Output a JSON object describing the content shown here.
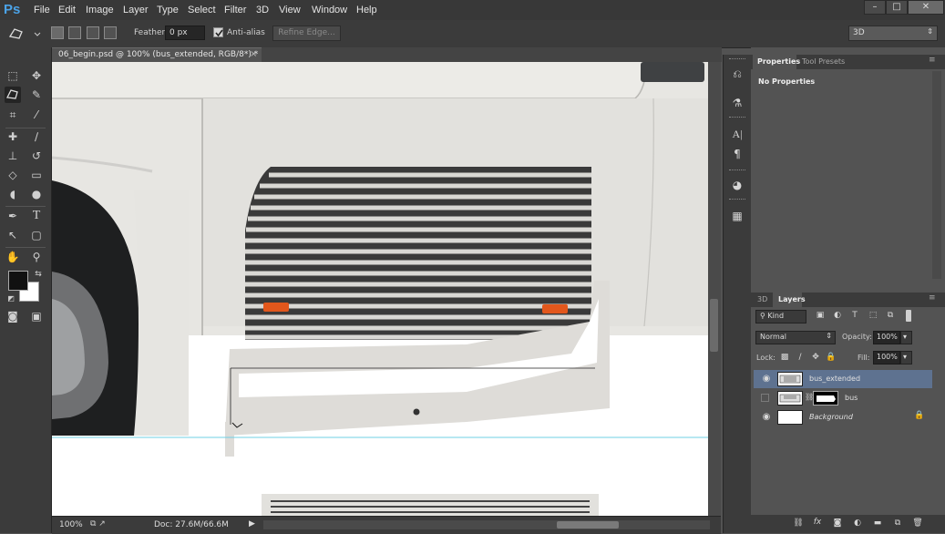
{
  "app": {
    "logo": "Ps"
  },
  "menu": [
    "File",
    "Edit",
    "Image",
    "Layer",
    "Type",
    "Select",
    "Filter",
    "3D",
    "View",
    "Window",
    "Help"
  ],
  "window_controls": {
    "minimize": "–",
    "restore": "□",
    "close": "✕"
  },
  "options_bar": {
    "feather_label": "Feather:",
    "feather_value": "0 px",
    "antialias_label": "Anti-alias",
    "antialias_checked": true,
    "refine_edge_label": "Refine Edge...",
    "workspace": "3D"
  },
  "document": {
    "tab_title": "06_begin.psd @ 100% (bus_extended, RGB/8*) *",
    "close": "×"
  },
  "status_bar": {
    "zoom": "100%",
    "doc_info": "Doc: 27.6M/66.6M"
  },
  "properties_panel": {
    "tabs": [
      "Properties",
      "Tool Presets"
    ],
    "active_tab": "Properties",
    "content": "No Properties"
  },
  "layers_panel": {
    "tabs": [
      "3D",
      "Layers"
    ],
    "active_tab": "Layers",
    "filter_kind": "Kind",
    "blend_mode": "Normal",
    "opacity_label": "Opacity:",
    "opacity_value": "100%",
    "lock_label": "Lock:",
    "fill_label": "Fill:",
    "fill_value": "100%",
    "layers": [
      {
        "name": "bus_extended",
        "visible": true,
        "selected": true,
        "italic": false
      },
      {
        "name": "bus",
        "visible": false,
        "selected": false,
        "italic": false
      },
      {
        "name": "Background",
        "visible": true,
        "selected": false,
        "italic": true
      }
    ]
  },
  "colors": {
    "accent": "#4ba3e8",
    "selected_layer": "#5e7290",
    "panel_bg": "#535353",
    "dark_bg": "#3b3b3b"
  }
}
